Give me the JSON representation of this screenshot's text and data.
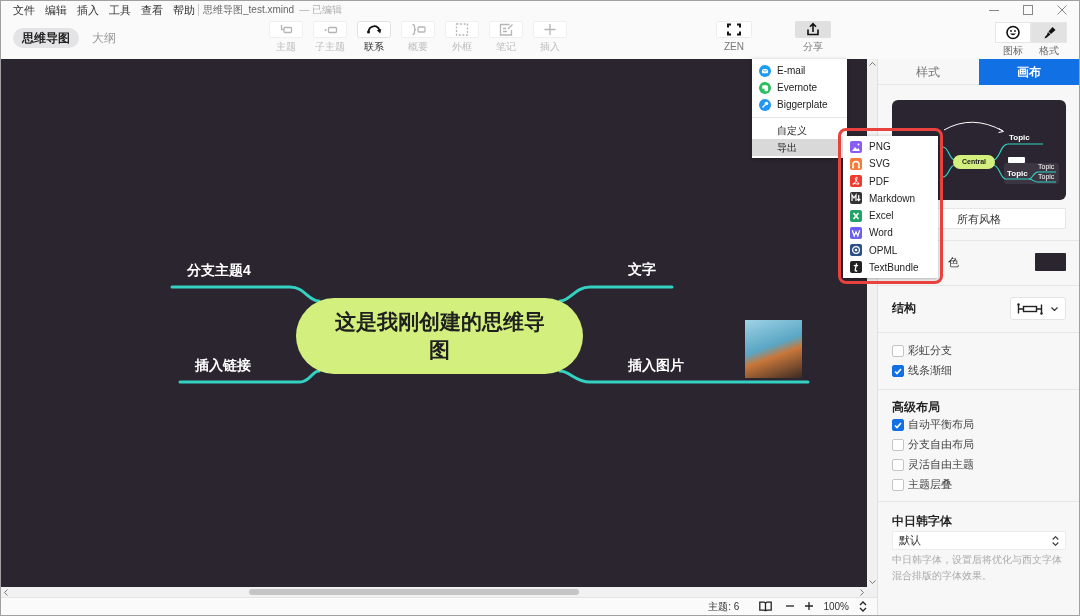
{
  "window": {
    "menu": [
      "文件",
      "编辑",
      "插入",
      "工具",
      "查看",
      "帮助"
    ],
    "file_name": "思维导图_test.xmind",
    "edit_status": "— 已编辑"
  },
  "view_tabs": [
    {
      "label": "思维导图",
      "selected": true
    },
    {
      "label": "大纲",
      "selected": false
    }
  ],
  "toolbar": [
    {
      "label": "主题",
      "disabled": true
    },
    {
      "label": "子主题",
      "disabled": true
    },
    {
      "label": "联系",
      "disabled": false
    },
    {
      "label": "概要",
      "disabled": true
    },
    {
      "label": "外框",
      "disabled": true
    },
    {
      "label": "笔记",
      "disabled": true
    },
    {
      "label": "插入",
      "disabled": true
    }
  ],
  "view_buttons": [
    {
      "label": "ZEN",
      "active": false
    },
    {
      "label": "分享",
      "active": true
    }
  ],
  "panel_toggles": [
    {
      "label": "图标",
      "selected": false
    },
    {
      "label": "格式",
      "selected": true
    }
  ],
  "mind_map": {
    "central_topic": "这是我刚创建的思维导图",
    "left_branches": [
      {
        "label": "分支主题4"
      },
      {
        "label": "插入链接"
      }
    ],
    "right_branches": [
      {
        "label": "文字"
      },
      {
        "label": "插入图片",
        "image": true
      }
    ]
  },
  "share_menu": {
    "services": [
      "E-mail",
      "Evernote",
      "Biggerplate"
    ],
    "items": [
      {
        "label": "自定义",
        "highlighted": false
      },
      {
        "label": "导出",
        "highlighted": true
      }
    ]
  },
  "export_menu": {
    "items": [
      "PNG",
      "SVG",
      "PDF",
      "Markdown",
      "Excel",
      "Word",
      "OPML",
      "TextBundle"
    ],
    "highlight_frame": true
  },
  "format_panel": {
    "tabs": [
      {
        "label": "样式",
        "selected": false
      },
      {
        "label": "画布",
        "selected": true
      }
    ],
    "theme_preview": {
      "central": "Central",
      "topic": "Topic",
      "floating_topic": "Topic",
      "subtopics": [
        "Topic",
        "Topic"
      ]
    },
    "all_styles": "所有风格",
    "background_label": "色",
    "structure_label": "结构",
    "branch_options": [
      {
        "label": "彩虹分支",
        "checked": false
      },
      {
        "label": "线条渐细",
        "checked": true
      }
    ],
    "advanced_layout": {
      "title": "高级布局",
      "options": [
        {
          "label": "自动平衡布局",
          "checked": true
        },
        {
          "label": "分支自由布局",
          "checked": false
        },
        {
          "label": "灵活自由主题",
          "checked": false
        },
        {
          "label": "主题层叠",
          "checked": false
        }
      ]
    },
    "cjk_font": {
      "title": "中日韩字体",
      "value": "默认",
      "hint": "中日韩字体，设置后将优化与西文字体混合排版的字体效果。"
    }
  },
  "status_bar": {
    "topic_count": "主题: 6",
    "zoom": "100%"
  }
}
